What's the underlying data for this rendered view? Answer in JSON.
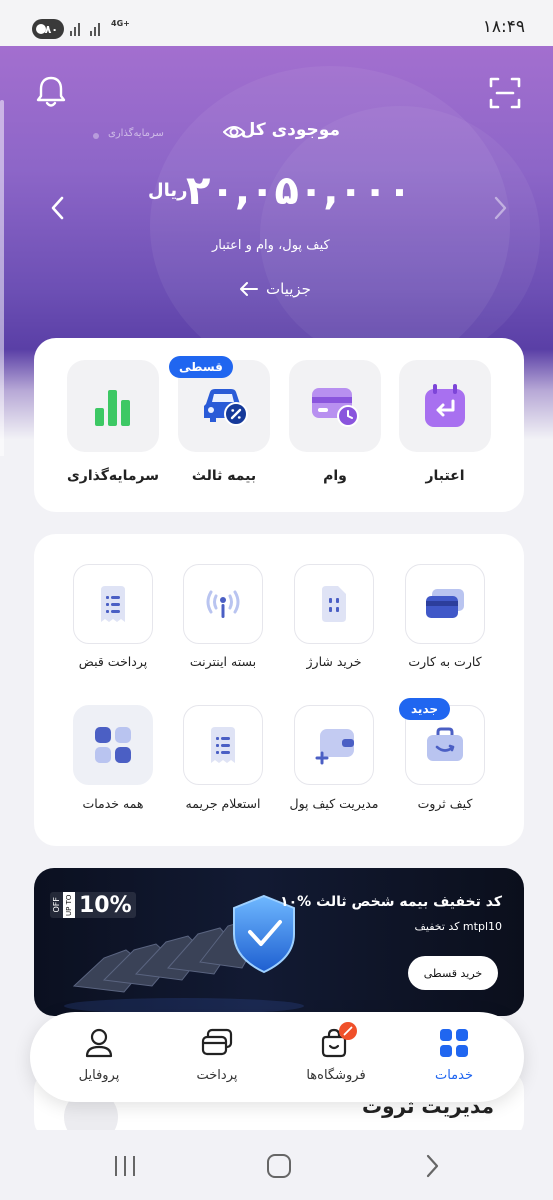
{
  "status_bar": {
    "time": "۱۸:۴۹",
    "battery": "۸۰",
    "network": "4G+"
  },
  "hero": {
    "total_label": "موجودی کل",
    "invest_tab": "سرمایه‌گذاری",
    "amount": "۲۰,۰۵۰,۰۰۰",
    "currency": "ریال",
    "subtitle": "کیف پول، وام و اعتبار",
    "details_label": "جزییات"
  },
  "main_services": [
    {
      "label": "اعتبار",
      "icon": "credit-calendar-icon"
    },
    {
      "label": "وام",
      "icon": "loan-card-icon"
    },
    {
      "label": "بیمه ثالث",
      "icon": "car-insurance-icon",
      "badge": "قسطی"
    },
    {
      "label": "سرمایه‌گذاری",
      "icon": "investment-bars-icon"
    }
  ],
  "services": [
    {
      "label": "کارت به کارت",
      "icon": "cards-icon"
    },
    {
      "label": "خرید شارژ",
      "icon": "sim-card-icon"
    },
    {
      "label": "بسته اینترنت",
      "icon": "antenna-icon"
    },
    {
      "label": "پرداخت قبض",
      "icon": "bill-icon"
    },
    {
      "label": "کیف ثروت",
      "icon": "wealth-bag-icon",
      "badge": "جدید"
    },
    {
      "label": "مدیریت کیف پول",
      "icon": "wallet-add-icon"
    },
    {
      "label": "استعلام جریمه",
      "icon": "fine-receipt-icon"
    },
    {
      "label": "همه خدمات",
      "icon": "grid-icon"
    }
  ],
  "banner": {
    "title": "۱۰% کد تخفیف بیمه شخص ثالث",
    "code_line": "کد تخفیف mtpl10",
    "button": "خرید قسطی",
    "off_text": "OFF",
    "upto_text": "UP TO",
    "percent": "10%"
  },
  "wealth_section": {
    "title": "مدیریت ثروت"
  },
  "bottom_nav": [
    {
      "label": "خدمات",
      "icon": "grid-icon",
      "active": true
    },
    {
      "label": "فروشگاه‌ها",
      "icon": "shopping-bag-icon",
      "active": false
    },
    {
      "label": "پرداخت",
      "icon": "payment-cards-icon",
      "active": false
    },
    {
      "label": "پروفایل",
      "icon": "profile-icon",
      "active": false
    }
  ],
  "colors": {
    "accent": "#2066f0",
    "hero_purple": "#8d66c8",
    "badge_red": "#f0502a"
  }
}
